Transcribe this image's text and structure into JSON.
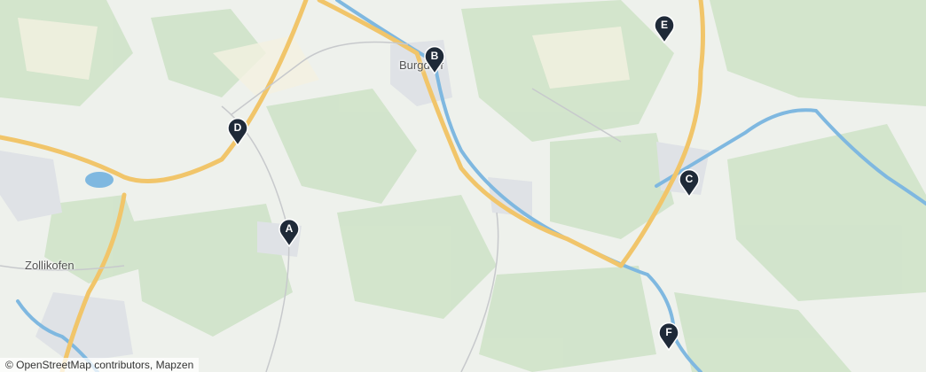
{
  "map": {
    "places": {
      "burgdorf": "Burgdorf",
      "zollikofen": "Zollikofen"
    },
    "markers": [
      {
        "id": "A",
        "label": "A"
      },
      {
        "id": "B",
        "label": "B"
      },
      {
        "id": "C",
        "label": "C"
      },
      {
        "id": "D",
        "label": "D"
      },
      {
        "id": "E",
        "label": "E"
      },
      {
        "id": "F",
        "label": "F"
      }
    ],
    "attribution": "© OpenStreetMap contributors, Mapzen",
    "colors": {
      "background": "#eef1ec",
      "forest": "#cfe3c9",
      "water": "#7fb8e0",
      "highway": "#f1c56a",
      "settlement": "#dfe2e6",
      "marker": "#1f2a38"
    }
  }
}
